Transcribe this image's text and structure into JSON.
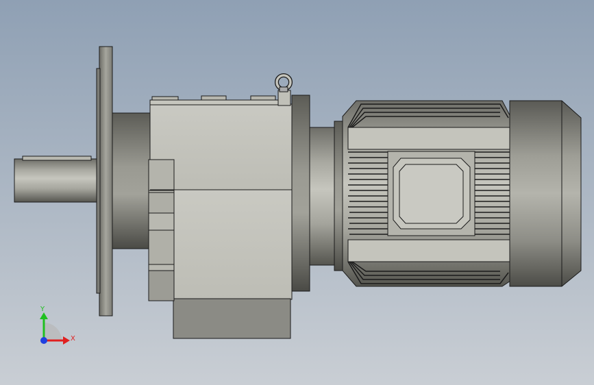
{
  "viewport": {
    "background_top": "#8fa0b4",
    "background_bottom": "#c9ced4"
  },
  "model": {
    "body_color": "#c4c4bc",
    "shadow_color": "#8a8a84",
    "edge_color": "#1a1a1a"
  },
  "triad": {
    "x_label": "X",
    "y_label": "Y",
    "x_color": "#e02020",
    "y_color": "#20c020",
    "z_color": "#2040e0"
  }
}
